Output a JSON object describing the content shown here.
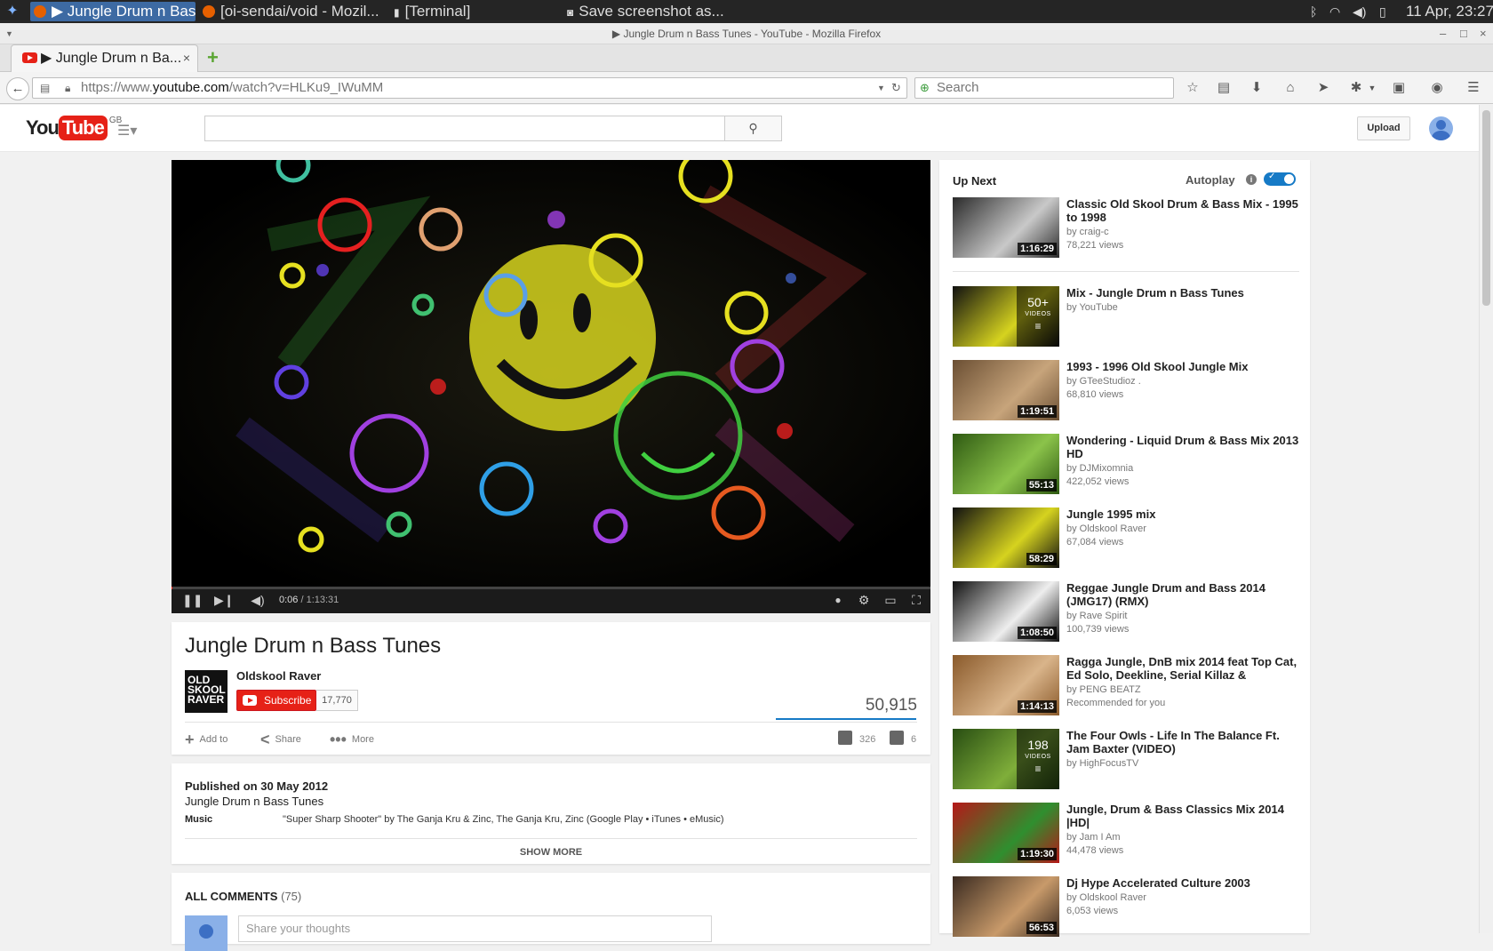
{
  "taskbar": {
    "tasks": [
      {
        "label": "▶ Jungle Drum n Bass...",
        "active": true
      },
      {
        "label": "[oi-sendai/void - Mozil...",
        "active": false
      },
      {
        "label": "[Terminal]",
        "active": false
      },
      {
        "label": "Save screenshot as...",
        "active": false
      }
    ],
    "clock": "11 Apr, 23:27"
  },
  "window": {
    "title": "▶ Jungle Drum n Bass Tunes - YouTube - Mozilla Firefox",
    "controls": [
      "–",
      "□",
      "×"
    ]
  },
  "browser": {
    "tab_label": "▶ Jungle Drum n Ba...",
    "tab_close": "×",
    "newtab": "+",
    "url_prefix": "https://www.",
    "url_domain": "youtube.com",
    "url_path": "/watch?v=HLKu9_IWuMM",
    "search_placeholder": "Search"
  },
  "youtube": {
    "logo_you": "You",
    "logo_tube": "Tube",
    "logo_country": "GB",
    "upload_label": "Upload"
  },
  "player": {
    "time_current": "0:06",
    "time_total": " / 1:13:31",
    "progress": 0.0014
  },
  "video": {
    "title": "Jungle Drum n Bass Tunes",
    "channel_name": "Oldskool Raver",
    "channel_logo_text": "OLD SKOOL RAVER",
    "subscribe_label": "Subscribe",
    "subscriber_count": "17,770",
    "view_count": "50,915",
    "add_to_label": "Add to",
    "share_label": "Share",
    "more_label": "More",
    "likes": "326",
    "dislikes": "6"
  },
  "description": {
    "published": "Published on 30 May 2012",
    "text": "Jungle Drum n Bass Tunes",
    "music_label": "Music",
    "music_value": "\"Super Sharp Shooter\" by The Ganja Kru & Zinc, The Ganja Kru, Zinc (Google Play • iTunes • eMusic)",
    "show_more": "SHOW MORE"
  },
  "comments": {
    "header": "ALL COMMENTS",
    "count": "(75)",
    "placeholder": "Share your thoughts"
  },
  "sidebar": {
    "up_next": "Up Next",
    "autoplay": "Autoplay",
    "autoplay_on": true,
    "videos": [
      {
        "title": "Classic Old Skool Drum & Bass Mix - 1995 to 1998",
        "by": "by craig-c",
        "views": "78,221 views",
        "duration": "1:16:29",
        "thumb_colors": [
          "#2a2a2a",
          "#c9c9c9"
        ]
      },
      {
        "title": "Mix - Jungle Drum n Bass Tunes",
        "by": "by YouTube",
        "views": "",
        "playlist_count": "50+",
        "playlist_label": "VIDEOS",
        "thumb_colors": [
          "#101010",
          "#d6d31f"
        ]
      },
      {
        "title": "1993 - 1996 Old Skool Jungle Mix",
        "by": "by GTeeStudioz .",
        "views": "68,810 views",
        "duration": "1:19:51",
        "thumb_colors": [
          "#6b4f33",
          "#c7a47b"
        ]
      },
      {
        "title": "Wondering - Liquid Drum & Bass Mix 2013 HD",
        "by": "by DJMixomnia",
        "views": "422,052 views",
        "duration": "55:13",
        "thumb_colors": [
          "#2f5a12",
          "#8bc34a"
        ]
      },
      {
        "title": "Jungle 1995 mix",
        "by": "by Oldskool Raver",
        "views": "67,084 views",
        "duration": "58:29",
        "thumb_colors": [
          "#101010",
          "#d6d31f"
        ]
      },
      {
        "title": "Reggae Jungle Drum and Bass 2014 (JMG17) (RMX)",
        "by": "by Rave Spirit",
        "views": "100,739 views",
        "duration": "1:08:50",
        "thumb_colors": [
          "#111111",
          "#eeeeee"
        ]
      },
      {
        "title": "Ragga Jungle, DnB mix 2014 feat Top Cat, Ed Solo, Deekline, Serial Killaz &",
        "by": "by PENG BEATZ",
        "views": "Recommended for you",
        "duration": "1:14:13",
        "thumb_colors": [
          "#8a5a2b",
          "#d9b48a"
        ]
      },
      {
        "title": "The Four Owls - Life In The Balance Ft. Jam Baxter (VIDEO)",
        "by": "by HighFocusTV",
        "views": "",
        "playlist_count": "198",
        "playlist_label": "VIDEOS",
        "thumb_colors": [
          "#284d12",
          "#7fae3a"
        ]
      },
      {
        "title": "Jungle, Drum & Bass Classics Mix 2014 |HD|",
        "by": "by Jam I Am",
        "views": "44,478 views",
        "duration": "1:19:30",
        "thumb_colors": [
          "#b51818",
          "#2f8f2f"
        ]
      },
      {
        "title": "Dj Hype Accelerated Culture 2003",
        "by": "by Oldskool Raver",
        "views": "6,053 views",
        "duration": "56:53",
        "thumb_colors": [
          "#3a2a20",
          "#c89a6a"
        ]
      }
    ]
  }
}
